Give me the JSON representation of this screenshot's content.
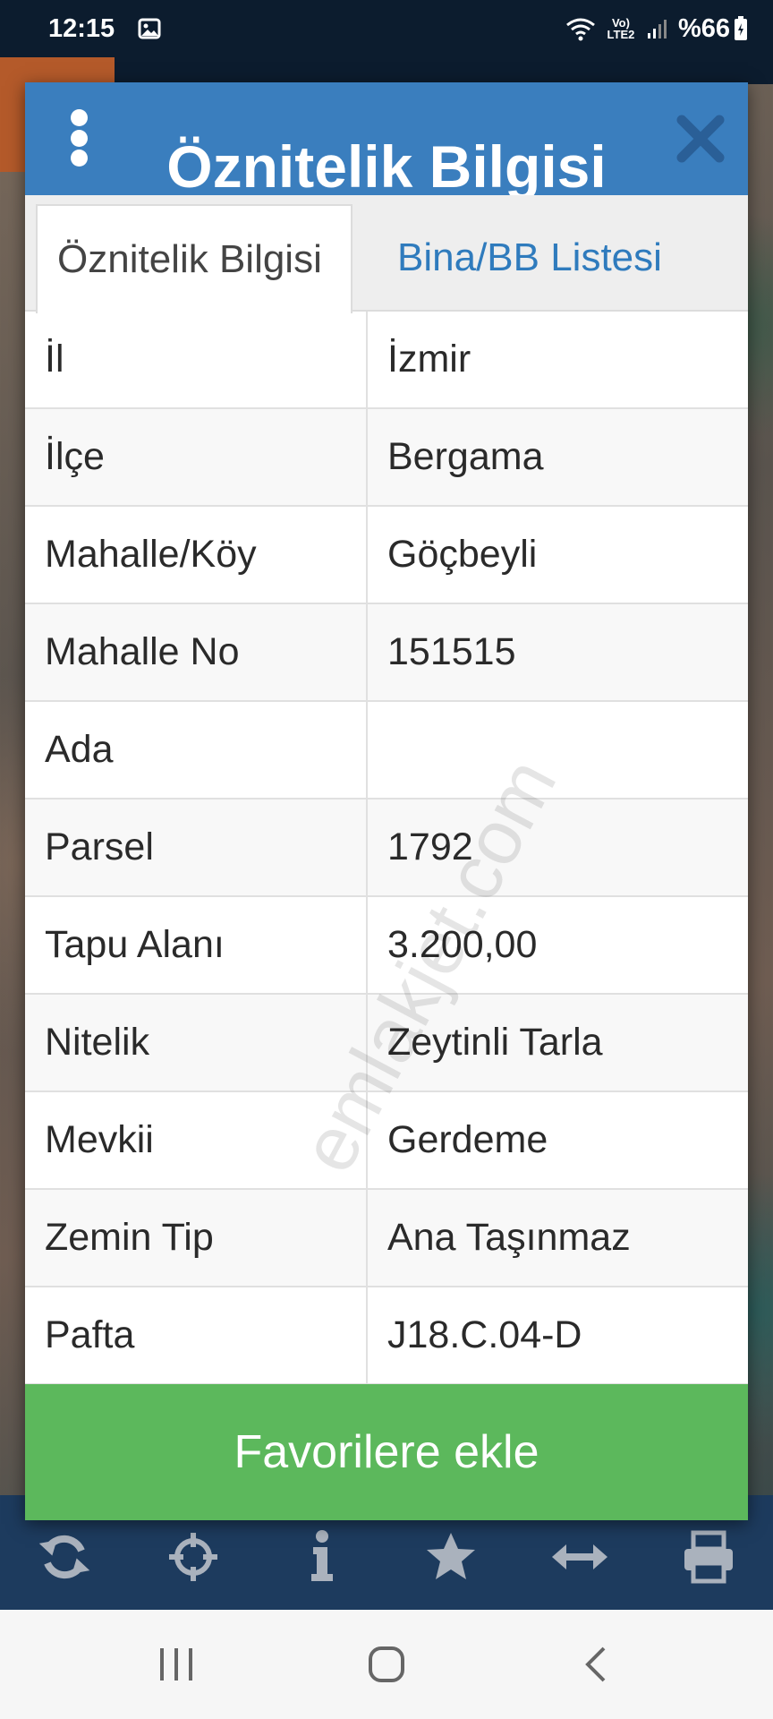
{
  "status_bar": {
    "time": "12:15",
    "network": "Vo) LTE2",
    "battery": "%66"
  },
  "dialog": {
    "title": "Öznitelik Bilgisi",
    "tabs": [
      {
        "label": "Öznitelik Bilgisi",
        "active": true
      },
      {
        "label": "Bina/BB Listesi",
        "active": false
      }
    ],
    "rows": [
      {
        "key": "İl",
        "value": "İzmir"
      },
      {
        "key": "İlçe",
        "value": "Bergama"
      },
      {
        "key": "Mahalle/Köy",
        "value": "Göçbeyli"
      },
      {
        "key": "Mahalle No",
        "value": "151515"
      },
      {
        "key": "Ada",
        "value": ""
      },
      {
        "key": "Parsel",
        "value": "1792"
      },
      {
        "key": "Tapu Alanı",
        "value": "3.200,00"
      },
      {
        "key": "Nitelik",
        "value": "Zeytinli Tarla"
      },
      {
        "key": "Mevkii",
        "value": "Gerdeme"
      },
      {
        "key": "Zemin Tip",
        "value": "Ana Taşınmaz"
      },
      {
        "key": "Pafta",
        "value": "J18.C.04-D"
      }
    ],
    "favorite_button": "Favorilere ekle"
  },
  "watermark": "emlakjet.com",
  "toolbar_icons": [
    "refresh-icon",
    "crosshair-icon",
    "info-icon",
    "star-icon",
    "measure-icon",
    "print-icon"
  ],
  "colors": {
    "header": "#3a7ebe",
    "tab_link": "#2f7bbd",
    "favorite": "#5cb85c",
    "toolbar": "#1d3b5e"
  }
}
